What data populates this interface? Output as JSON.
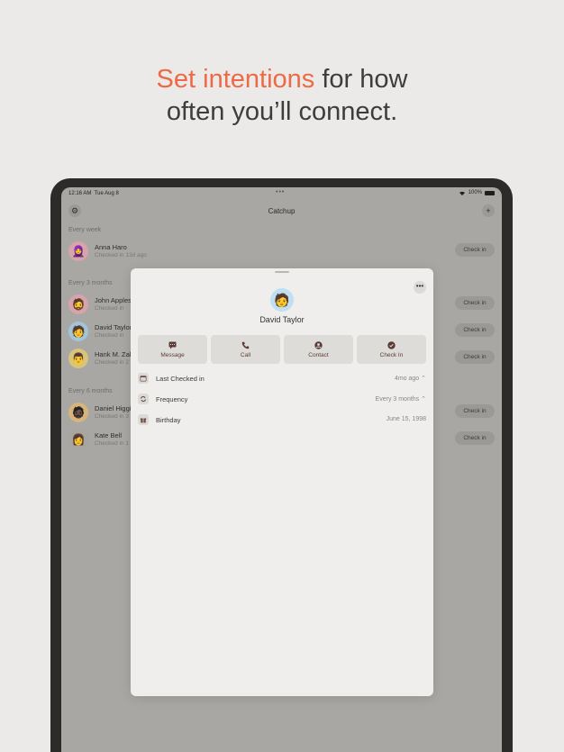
{
  "headline": {
    "accent": "Set intentions",
    "rest1": " for how",
    "line2": "often you’ll connect."
  },
  "status_bar": {
    "time": "12:16 AM",
    "date": "Tue Aug 8",
    "battery": "100%",
    "dots": "•••"
  },
  "navbar": {
    "title": "Catchup",
    "settings_icon": "gear-icon",
    "add_icon": "plus-icon"
  },
  "sections": [
    {
      "header": "Every week",
      "contacts": [
        {
          "name": "Anna Haro",
          "sub": "Checked in 13d ago",
          "emoji": "🧕",
          "color": "#e7a9b4",
          "button": "Check in"
        }
      ]
    },
    {
      "header": "Every 3 months",
      "contacts": [
        {
          "name": "John Appleseed",
          "sub": "Checked in",
          "emoji": "🧔",
          "color": "#e7a9b4",
          "button": "Check in"
        },
        {
          "name": "David Taylor",
          "sub": "Checked in",
          "emoji": "🧑",
          "color": "#a9d3e8",
          "button": "Check in"
        },
        {
          "name": "Hank M. Zakroff",
          "sub": "Checked in 2",
          "emoji": "👨",
          "color": "#e8d27a",
          "button": "Check in"
        }
      ]
    },
    {
      "header": "Every 6 months",
      "contacts": [
        {
          "name": "Daniel Higgins",
          "sub": "Checked in 3",
          "emoji": "🧔🏿",
          "color": "#e8c07a",
          "button": "Check in"
        },
        {
          "name": "Kate Bell",
          "sub": "Checked in 1",
          "emoji": "👩",
          "color": "#b9b6b2",
          "button": "Check in"
        }
      ]
    }
  ],
  "sheet": {
    "name": "David Taylor",
    "avatar_emoji": "🧑",
    "more": "•••",
    "actions": [
      {
        "label": "Message",
        "icon": "message-icon"
      },
      {
        "label": "Call",
        "icon": "phone-icon"
      },
      {
        "label": "Contact",
        "icon": "person-icon"
      },
      {
        "label": "Check In",
        "icon": "checkmark-icon"
      }
    ],
    "details": [
      {
        "label": "Last Checked in",
        "value": "4mo ago",
        "icon": "calendar-icon"
      },
      {
        "label": "Frequency",
        "value": "Every 3 months",
        "icon": "repeat-icon"
      },
      {
        "label": "Birthday",
        "value": "June 15, 1998",
        "icon": "gift-icon"
      }
    ]
  },
  "colors": {
    "accent": "#ec6a45",
    "action_text": "#5a3a34"
  }
}
